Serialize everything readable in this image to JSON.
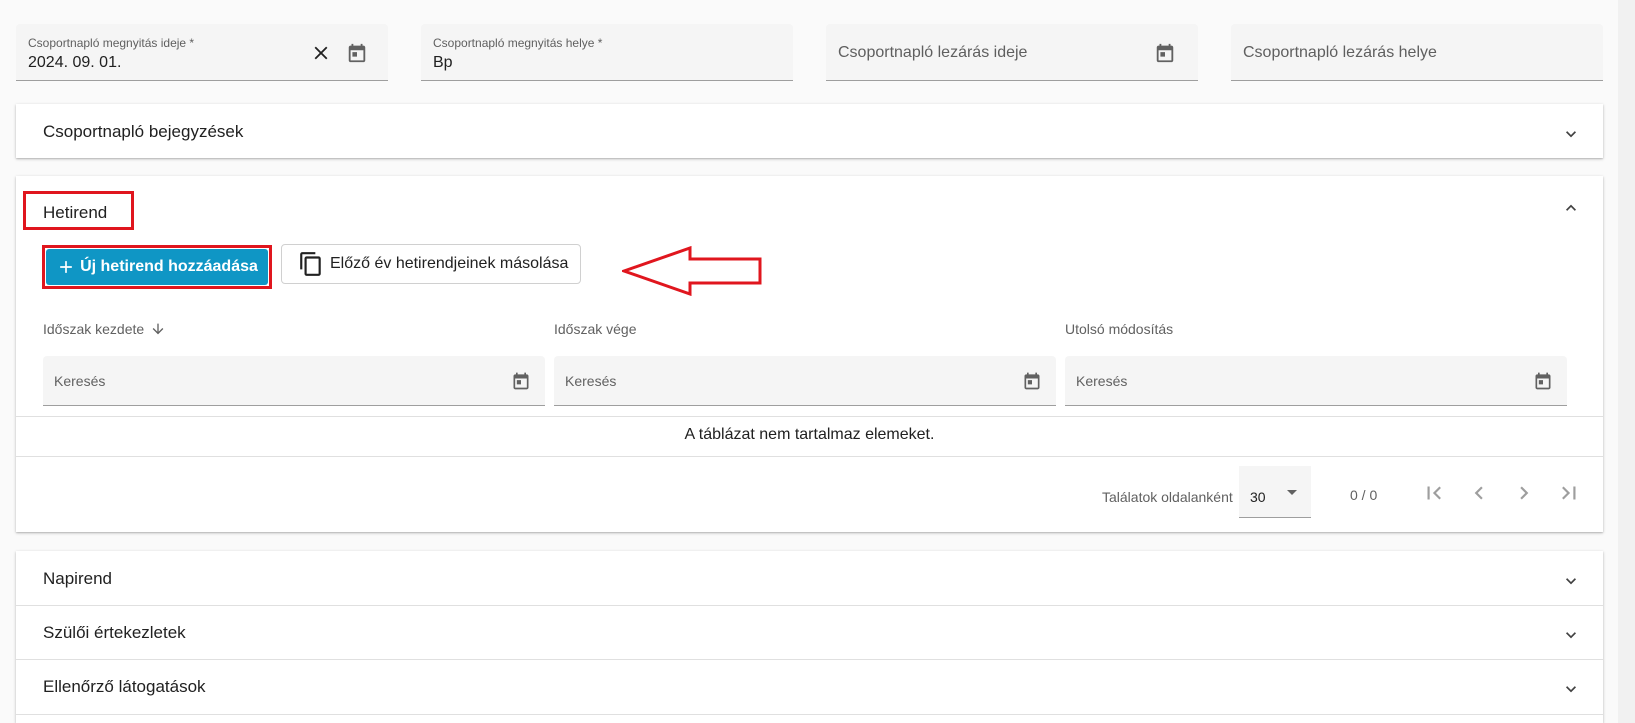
{
  "fields": {
    "open_date": {
      "label": "Csoportnapló megnyitás ideje *",
      "value": "2024. 09. 01."
    },
    "open_place": {
      "label": "Csoportnapló megnyitás helye *",
      "value": "Bp"
    },
    "close_date": {
      "placeholder": "Csoportnapló lezárás ideje"
    },
    "close_place": {
      "placeholder": "Csoportnapló lezárás helye"
    }
  },
  "panels": {
    "entries": {
      "title": "Csoportnapló bejegyzések"
    },
    "weekly": {
      "title": "Hetirend",
      "add_button": "Új hetirend hozzáadása",
      "copy_button": "Előző év hetirendjeinek másolása",
      "columns": [
        {
          "label": "Időszak kezdete",
          "search": "Keresés"
        },
        {
          "label": "Időszak vége",
          "search": "Keresés"
        },
        {
          "label": "Utolsó módosítás",
          "search": "Keresés"
        }
      ],
      "empty_text": "A táblázat nem tartalmaz elemeket.",
      "pager": {
        "label": "Találatok oldalanként",
        "page_size": "30",
        "range": "0 / 0"
      }
    },
    "daily": {
      "title": "Napirend"
    },
    "parents": {
      "title": "Szülői értekezletek"
    },
    "inspections": {
      "title": "Ellenőrző látogatások"
    }
  },
  "colors": {
    "primary": "#0f96c5",
    "highlight": "#e0161e"
  }
}
